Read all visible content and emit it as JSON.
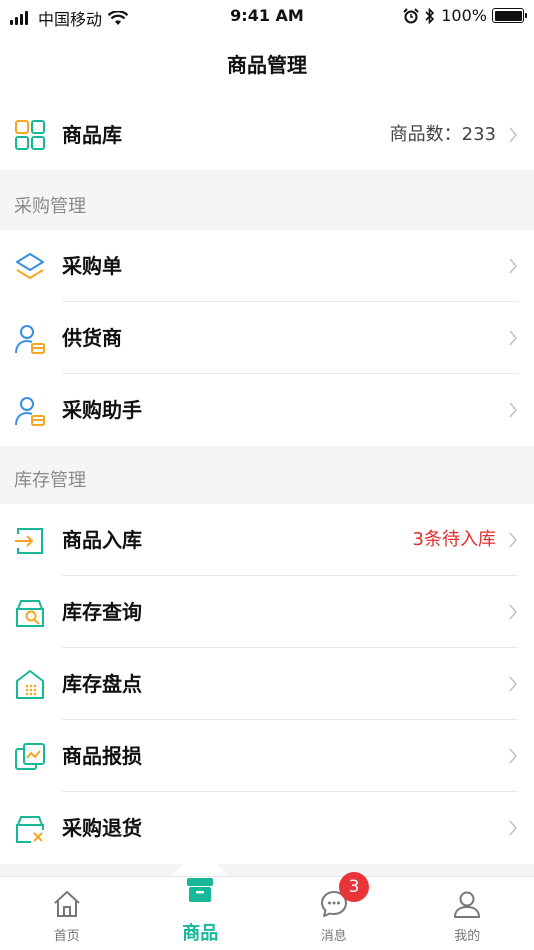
{
  "status_bar": {
    "carrier": "中国移动",
    "time": "9:41 AM",
    "battery": "100%"
  },
  "nav": {
    "title": "商品管理"
  },
  "library": {
    "label": "商品库",
    "value": "商品数：233"
  },
  "purchase_section": {
    "title": "采购管理",
    "items": [
      {
        "label": "采购单",
        "icon": "layers-icon"
      },
      {
        "label": "供货商",
        "icon": "supplier-icon"
      },
      {
        "label": "采购助手",
        "icon": "assistant-icon"
      }
    ]
  },
  "inventory_section": {
    "title": "库存管理",
    "items": [
      {
        "label": "商品入库",
        "value": "3条待入库",
        "icon": "stock-in-icon"
      },
      {
        "label": "库存查询",
        "icon": "stock-search-icon"
      },
      {
        "label": "库存盘点",
        "icon": "stock-count-icon"
      },
      {
        "label": "商品报损",
        "icon": "damage-report-icon"
      },
      {
        "label": "采购退货",
        "icon": "purchase-return-icon"
      }
    ]
  },
  "tabs": [
    {
      "label": "首页",
      "icon": "home-icon",
      "active": false
    },
    {
      "label": "商品",
      "icon": "goods-icon",
      "active": true
    },
    {
      "label": "消息",
      "icon": "message-icon",
      "active": false,
      "badge": "3"
    },
    {
      "label": "我的",
      "icon": "profile-icon",
      "active": false
    }
  ],
  "colors": {
    "accent": "#17b89a",
    "orange": "#f5a623",
    "blue": "#3b8ee6",
    "alert": "#e0302b"
  }
}
